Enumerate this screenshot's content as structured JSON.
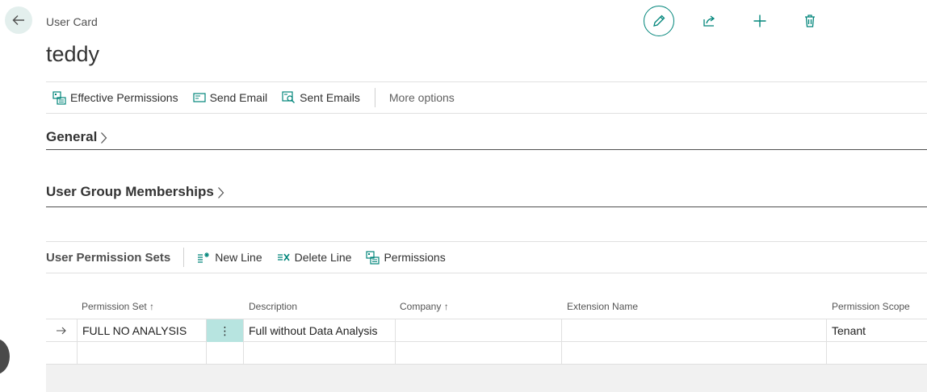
{
  "header": {
    "caption": "User Card",
    "title": "teddy"
  },
  "top_actions": [
    {
      "name": "edit-button",
      "icon": "pencil-icon"
    },
    {
      "name": "share-button",
      "icon": "share-icon"
    },
    {
      "name": "new-button",
      "icon": "plus-icon"
    },
    {
      "name": "delete-button",
      "icon": "trash-icon"
    }
  ],
  "actions": {
    "effective_permissions": "Effective Permissions",
    "send_email": "Send Email",
    "sent_emails": "Sent Emails",
    "more_options": "More options"
  },
  "sections": {
    "general": "General",
    "user_groups": "User Group Memberships"
  },
  "permission_sets": {
    "title": "User Permission Sets",
    "new_line": "New Line",
    "delete_line": "Delete Line",
    "permissions": "Permissions",
    "columns": {
      "permission_set": "Permission Set",
      "description": "Description",
      "company": "Company",
      "extension_name": "Extension Name",
      "scope": "Permission Scope"
    },
    "rows": [
      {
        "permission_set": "FULL NO ANALYSIS",
        "description": "Full without Data Analysis",
        "company": "",
        "extension_name": "",
        "scope": "Tenant"
      }
    ]
  },
  "colors": {
    "accent": "#00857a",
    "selected_cell": "#b7e4e0"
  }
}
